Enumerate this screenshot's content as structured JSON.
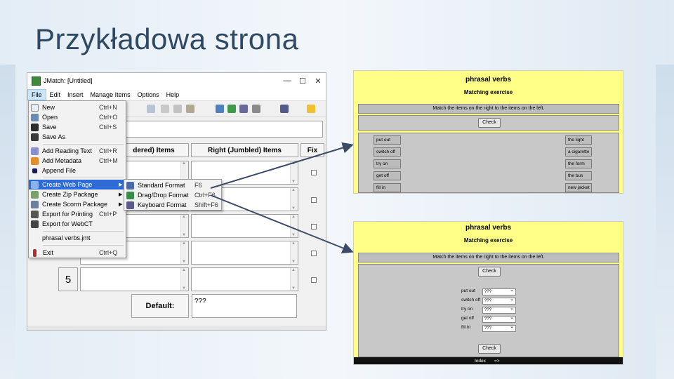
{
  "slide": {
    "title": "Przykładowa strona"
  },
  "window": {
    "title": "JMatch: [Untitled]",
    "controls": {
      "minimize": "—",
      "maximize": "☐",
      "close": "✕"
    },
    "menu": [
      "File",
      "Edit",
      "Insert",
      "Manage Items",
      "Options",
      "Help"
    ],
    "col_left_partial": "dered) Items",
    "col_right": "Right (Jumbled) Items",
    "col_fix": "Fix",
    "row_five": "5",
    "default_label": "Default:",
    "default_value": "???"
  },
  "file_menu": {
    "items": [
      {
        "label": "New",
        "shortcut": "Ctrl+N"
      },
      {
        "label": "Open",
        "shortcut": "Ctrl+O"
      },
      {
        "label": "Save",
        "shortcut": "Ctrl+S"
      },
      {
        "label": "Save As",
        "shortcut": ""
      },
      {
        "label": "Add Reading Text",
        "shortcut": "Ctrl+R"
      },
      {
        "label": "Add Metadata",
        "shortcut": "Ctrl+M"
      },
      {
        "label": "Append File",
        "shortcut": ""
      },
      {
        "label": "Create Web Page",
        "shortcut": ""
      },
      {
        "label": "Create Zip Package",
        "shortcut": ""
      },
      {
        "label": "Create Scorm Package",
        "shortcut": ""
      },
      {
        "label": "Export for Printing",
        "shortcut": "Ctrl+P"
      },
      {
        "label": "Export for WebCT",
        "shortcut": ""
      },
      {
        "label": "phrasal verbs.jmt",
        "shortcut": ""
      },
      {
        "label": "Exit",
        "shortcut": "Ctrl+Q"
      }
    ],
    "submenu": [
      {
        "label": "Standard Format",
        "shortcut": "F6"
      },
      {
        "label": "Drag/Drop Format",
        "shortcut": "Ctrl+F6"
      },
      {
        "label": "Keyboard Format",
        "shortcut": "Shift+F6"
      }
    ]
  },
  "preview": {
    "title": "phrasal verbs",
    "subtitle": "Matching exercise",
    "instructions": "Match the items on the right to the items on the left.",
    "check": "Check",
    "left_items": [
      "put out",
      "switch off",
      "try on",
      "get off",
      "fill in"
    ],
    "right_items": [
      "the light",
      "a cigarette",
      "the form",
      "the bus",
      "new jacket"
    ],
    "dropdown_value": "???",
    "nav": [
      "Index",
      "=>"
    ]
  },
  "colors": {
    "yellow": "#ffff88",
    "menu_highlight": "#2f6bd6",
    "arrow": "#3b4b66"
  }
}
